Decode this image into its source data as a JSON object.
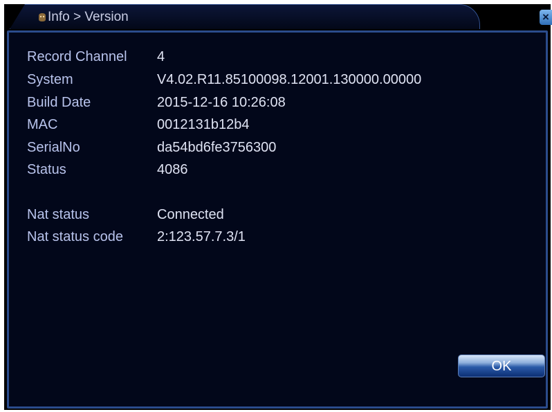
{
  "window": {
    "title": "Info > Version",
    "close_label": "×"
  },
  "info": {
    "rows": [
      {
        "label": "Record Channel",
        "value": "4"
      },
      {
        "label": "System",
        "value": "V4.02.R11.85100098.12001.130000.00000"
      },
      {
        "label": "Build Date",
        "value": "2015-12-16 10:26:08"
      },
      {
        "label": "MAC",
        "value": "0012131b12b4"
      },
      {
        "label": "SerialNo",
        "value": "da54bd6fe3756300"
      },
      {
        "label": "Status",
        "value": "4086"
      },
      {
        "label": "Nat status",
        "value": "Connected"
      },
      {
        "label": "Nat status code",
        "value": "2:123.57.7.3/1"
      }
    ]
  },
  "buttons": {
    "ok_label": "OK"
  },
  "colors": {
    "background": "#02071a",
    "border": "#2b4c8c",
    "label_text": "#b8c3ec",
    "value_text": "#dfe3f3"
  }
}
